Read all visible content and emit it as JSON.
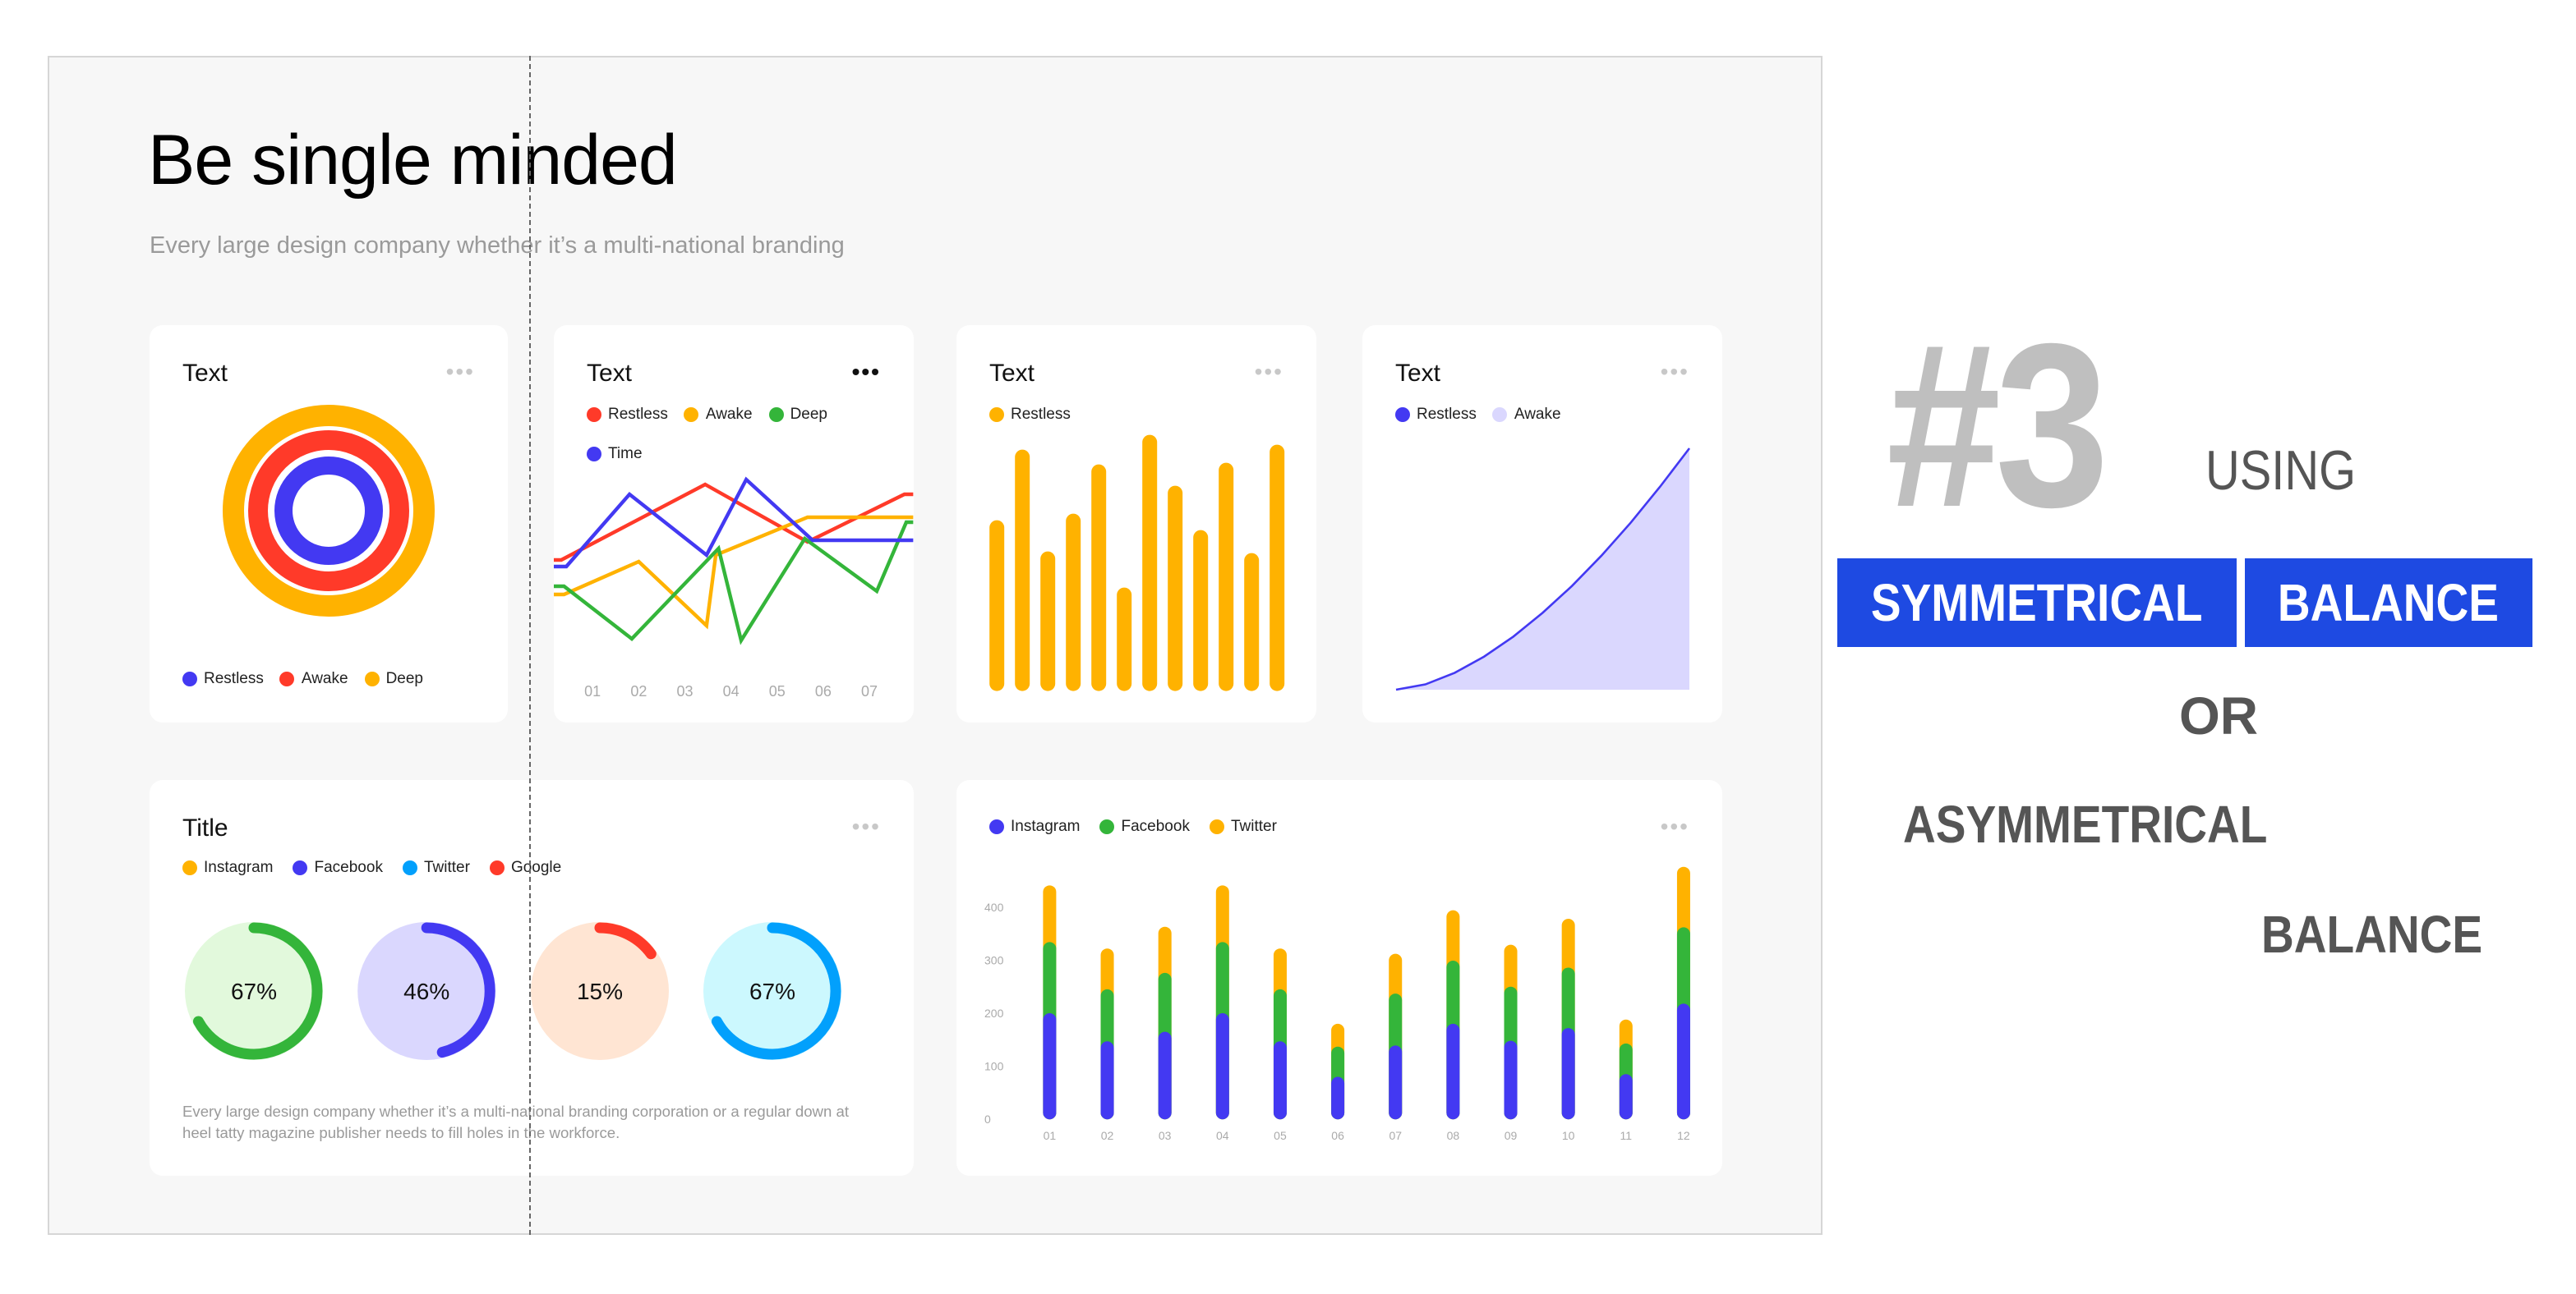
{
  "heading": {
    "title": "Be single minded",
    "subtitle": "Every large design company whether it’s a multi-national branding"
  },
  "colors": {
    "blue": "#4339f2",
    "red": "#ff3a29",
    "orange": "#ffb200",
    "green": "#34b53a",
    "cyan": "#02a0fc",
    "lavender": "#dad7fe",
    "tag": "#1e4ae2"
  },
  "cards": {
    "rings": {
      "title": "Text",
      "menu": "•••",
      "legend": [
        {
          "label": "Restless",
          "color": "#4339f2"
        },
        {
          "label": "Awake",
          "color": "#ff3a29"
        },
        {
          "label": "Deep",
          "color": "#ffb200"
        }
      ]
    },
    "lines": {
      "title": "Text",
      "menu": "•••",
      "legend": [
        {
          "label": "Restless",
          "color": "#ff3a29"
        },
        {
          "label": "Awake",
          "color": "#ffb200"
        },
        {
          "label": "Deep",
          "color": "#34b53a"
        },
        {
          "label": "Time",
          "color": "#4339f2"
        }
      ]
    },
    "bars": {
      "title": "Text",
      "menu": "•••",
      "legend": [
        {
          "label": "Restless",
          "color": "#ffb200"
        }
      ]
    },
    "area": {
      "title": "Text",
      "menu": "•••",
      "legend": [
        {
          "label": "Restless",
          "color": "#4339f2"
        },
        {
          "label": "Awake",
          "color": "#dad7fe"
        }
      ]
    },
    "donuts": {
      "title": "Title",
      "menu": "•••",
      "legend": [
        {
          "label": "Instagram",
          "color": "#ffb200"
        },
        {
          "label": "Facebook",
          "color": "#4339f2"
        },
        {
          "label": "Twitter",
          "color": "#02a0fc"
        },
        {
          "label": "Google",
          "color": "#ff3a29"
        }
      ],
      "description": "Every large design company whether it’s a multi-national branding corporation or a regular down at heel tatty magazine publisher needs to fill holes in the workforce."
    },
    "stacked": {
      "menu": "•••",
      "legend": [
        {
          "label": "Instagram",
          "color": "#4339f2"
        },
        {
          "label": "Facebook",
          "color": "#34b53a"
        },
        {
          "label": "Twitter",
          "color": "#ffb200"
        }
      ]
    }
  },
  "side": {
    "number": "#3",
    "using": "USING",
    "tag1": "SYMMETRICAL",
    "tag2": "BALANCE",
    "or": "OR",
    "asymmetrical": "ASYMMETRICAL",
    "balance": "BALANCE"
  },
  "chart_data": [
    {
      "type": "pie",
      "variant": "concentric-rings",
      "series": [
        {
          "name": "Restless",
          "color": "#4339f2"
        },
        {
          "name": "Awake",
          "color": "#ff3a29"
        },
        {
          "name": "Deep",
          "color": "#ffb200"
        }
      ]
    },
    {
      "type": "line",
      "categories": [
        "01",
        "02",
        "03",
        "04",
        "05",
        "06",
        "07"
      ],
      "ylim": [
        0,
        100
      ],
      "grid": false,
      "series": [
        {
          "name": "Restless",
          "color": "#ff3a29",
          "points": [
            [
              0.13,
              49
            ],
            [
              0.32,
              49
            ],
            [
              3.44,
              95
            ],
            [
              5.66,
              60
            ],
            [
              7.76,
              89
            ],
            [
              7.95,
              89
            ]
          ]
        },
        {
          "name": "Awake",
          "color": "#ffb200",
          "points": [
            [
              0.13,
              28
            ],
            [
              0.38,
              28
            ],
            [
              2.0,
              48
            ],
            [
              3.47,
              9
            ],
            [
              3.67,
              52
            ],
            [
              5.66,
              75
            ],
            [
              7.95,
              75
            ]
          ]
        },
        {
          "name": "Deep",
          "color": "#34b53a",
          "points": [
            [
              0.13,
              33
            ],
            [
              0.38,
              33
            ],
            [
              1.85,
              1
            ],
            [
              3.73,
              56
            ],
            [
              4.22,
              0
            ],
            [
              5.6,
              62
            ],
            [
              7.16,
              30
            ],
            [
              7.8,
              72
            ],
            [
              7.95,
              72
            ]
          ]
        },
        {
          "name": "Time",
          "color": "#4339f2",
          "points": [
            [
              0.13,
              45
            ],
            [
              0.43,
              45
            ],
            [
              1.8,
              89
            ],
            [
              3.47,
              52
            ],
            [
              4.33,
              98
            ],
            [
              5.77,
              61
            ],
            [
              7.95,
              61
            ]
          ]
        }
      ]
    },
    {
      "type": "bar",
      "ylim": [
        0,
        160
      ],
      "grid": false,
      "series": [
        {
          "name": "Restless",
          "color": "#ffb200",
          "values": [
            104,
            147,
            85,
            108,
            138,
            63,
            156,
            125,
            98,
            139,
            84,
            150
          ]
        }
      ]
    },
    {
      "type": "area",
      "ylim": [
        0,
        100
      ],
      "xlim": [
        0,
        100
      ],
      "grid": false,
      "x": [
        0,
        10,
        20,
        30,
        40,
        50,
        60,
        70,
        80,
        90,
        100
      ],
      "series": [
        {
          "name": "Restless",
          "color": "#4339f2",
          "values": [
            0,
            2.2,
            7.0,
            13.7,
            22.0,
            31.9,
            43.0,
            55.5,
            69.2,
            84.1,
            100
          ]
        }
      ],
      "fill_color": "#dad7fe"
    },
    {
      "type": "pie",
      "variant": "progress-rings",
      "values": [
        67,
        46,
        15,
        67
      ],
      "labels": [
        "67%",
        "46%",
        "15%",
        "67%"
      ],
      "colors": [
        {
          "arc": "#34b53a",
          "fill": "#e2f9dc"
        },
        {
          "arc": "#4339f2",
          "fill": "#dad7fe"
        },
        {
          "arc": "#ff3a29",
          "fill": "#ffe5d3"
        },
        {
          "arc": "#02a0fc",
          "fill": "#ccf8fe"
        }
      ]
    },
    {
      "type": "bar",
      "stacked": true,
      "ylim": [
        0,
        480
      ],
      "grid": false,
      "categories": [
        "01",
        "02",
        "03",
        "04",
        "05",
        "06",
        "07",
        "08",
        "09",
        "10",
        "11",
        "12"
      ],
      "yticks": [
        "0",
        "100",
        "200",
        "300",
        "400"
      ],
      "series": [
        {
          "name": "Instagram",
          "color": "#4339f2",
          "values": [
            200,
            147,
            165,
            200,
            147,
            80,
            139,
            180,
            148,
            172,
            85,
            218
          ]
        },
        {
          "name": "Facebook",
          "color": "#34b53a",
          "values": [
            134,
            98,
            111,
            134,
            98,
            57,
            98,
            119,
            102,
            114,
            58,
            144
          ]
        },
        {
          "name": "Twitter",
          "color": "#ffb200",
          "values": [
            107,
            77,
            87,
            107,
            77,
            43,
            75,
            95,
            79,
            92,
            45,
            114
          ]
        }
      ]
    }
  ]
}
